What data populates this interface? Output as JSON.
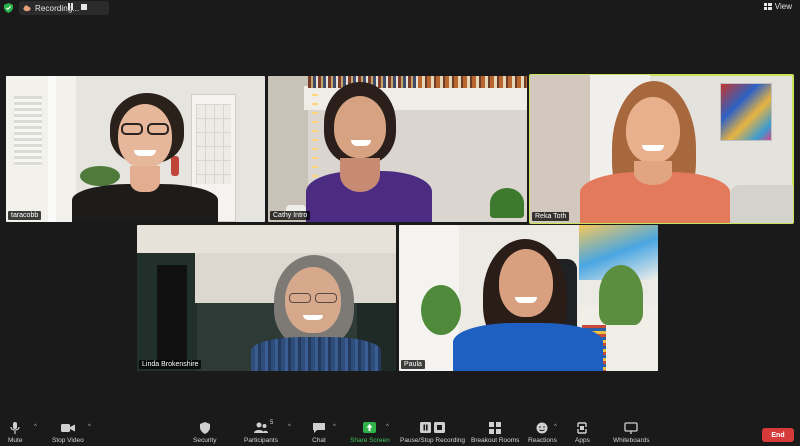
{
  "recording": {
    "label": "Recording..."
  },
  "view": {
    "label": "View"
  },
  "participants_tiles": [
    {
      "name": "taracobb"
    },
    {
      "name": "Cathy Intro"
    },
    {
      "name": "Reka Toth"
    },
    {
      "name": "Linda Brokenshire"
    },
    {
      "name": "Paula"
    }
  ],
  "toolbar": {
    "mute": "Mute",
    "stop_video": "Stop Video",
    "security": "Security",
    "participants": "Participants",
    "participants_count": "5",
    "chat": "Chat",
    "share_screen": "Share Screen",
    "record": "Pause/Stop Recording",
    "breakout": "Breakout Rooms",
    "reactions": "Reactions",
    "apps": "Apps",
    "whiteboards": "Whiteboards",
    "end": "End"
  },
  "colors": {
    "active_speaker": "#c6e35a",
    "share": "#30b24a",
    "end": "#d63a3a",
    "recording": "#e8a07a"
  }
}
